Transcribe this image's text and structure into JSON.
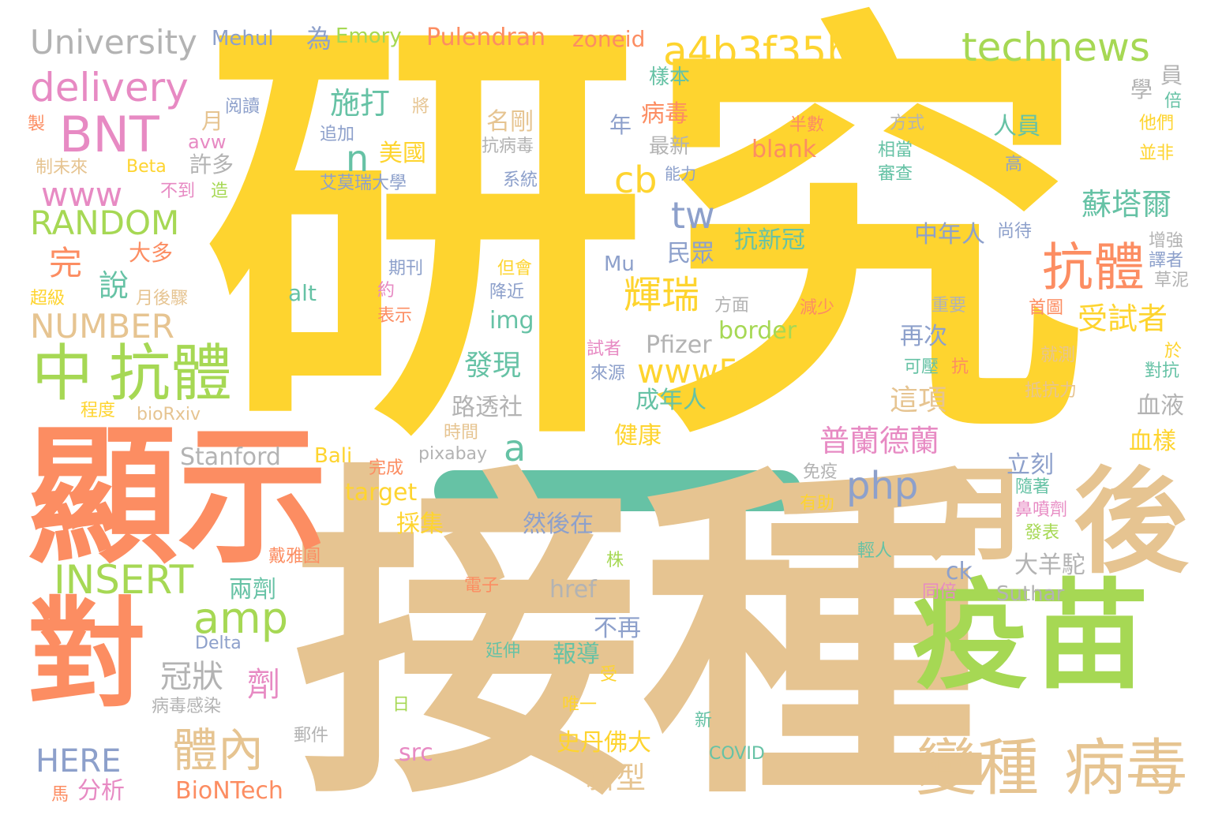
{
  "palette": {
    "yellow": "#fed42f",
    "tan": "#e6c491",
    "salmon": "#fc8d62",
    "green": "#a6d854",
    "pink": "#e78ac3",
    "blue": "#8da0cb",
    "teal": "#66c2a5",
    "gray": "#b3b3b3",
    "background": "#ffffff"
  },
  "highlight_bar": {
    "color": "#66c2a5"
  },
  "words": [
    {
      "text": "研究",
      "color": "yellow"
    },
    {
      "text": "接種",
      "color": "tan"
    },
    {
      "text": "顯示",
      "color": "salmon"
    },
    {
      "text": "對",
      "color": "salmon"
    },
    {
      "text": "疫苗",
      "color": "green"
    },
    {
      "text": "後",
      "color": "tan"
    },
    {
      "text": "月",
      "color": "tan"
    },
    {
      "text": "變種",
      "color": "tan"
    },
    {
      "text": "病毒",
      "color": "tan"
    },
    {
      "text": "中",
      "color": "green"
    },
    {
      "text": "抗體",
      "color": "green"
    },
    {
      "text": "BNT",
      "color": "pink"
    },
    {
      "text": "delivery",
      "color": "pink"
    },
    {
      "text": "University",
      "color": "gray"
    },
    {
      "text": "a4b3f35b",
      "color": "yellow"
    },
    {
      "text": "technews",
      "color": "green"
    },
    {
      "text": "www",
      "color": "pink"
    },
    {
      "text": "RANDOM",
      "color": "green"
    },
    {
      "text": "NUMBER",
      "color": "tan"
    },
    {
      "text": "INSERT",
      "color": "green"
    },
    {
      "text": "amp",
      "color": "green"
    },
    {
      "text": "php",
      "color": "blue"
    },
    {
      "text": "www5",
      "color": "yellow"
    },
    {
      "text": "抗體",
      "color": "salmon"
    },
    {
      "text": "輝瑞",
      "color": "yellow"
    },
    {
      "text": "受試者",
      "color": "yellow"
    },
    {
      "text": "蘇塔爾",
      "color": "teal"
    },
    {
      "text": "普蘭德蘭",
      "color": "pink"
    },
    {
      "text": "體內",
      "color": "tan"
    },
    {
      "text": "cb",
      "color": "yellow"
    },
    {
      "text": "tw",
      "color": "blue"
    },
    {
      "text": "施打",
      "color": "teal"
    },
    {
      "text": "n",
      "color": "teal"
    },
    {
      "text": "a",
      "color": "teal"
    },
    {
      "text": "HERE",
      "color": "blue"
    },
    {
      "text": "冠狀",
      "color": "gray"
    },
    {
      "text": "劑",
      "color": "pink"
    },
    {
      "text": "完",
      "color": "salmon"
    },
    {
      "text": "說",
      "color": "teal"
    },
    {
      "text": "發現",
      "color": "teal"
    },
    {
      "text": "這項",
      "color": "tan"
    },
    {
      "text": "新型",
      "color": "tan"
    },
    {
      "text": "史丹佛大",
      "color": "yellow"
    },
    {
      "text": "美國",
      "color": "yellow"
    },
    {
      "text": "名剛",
      "color": "tan"
    },
    {
      "text": "病毒",
      "color": "salmon"
    },
    {
      "text": "樣本",
      "color": "teal"
    },
    {
      "text": "最新",
      "color": "gray"
    },
    {
      "text": "年",
      "color": "blue"
    },
    {
      "text": "許多",
      "color": "gray"
    },
    {
      "text": "avw",
      "color": "pink"
    },
    {
      "text": "月",
      "color": "tan"
    },
    {
      "text": "大多",
      "color": "salmon"
    },
    {
      "text": "為",
      "color": "blue"
    },
    {
      "text": "Mehul",
      "color": "blue"
    },
    {
      "text": "Emory",
      "color": "green"
    },
    {
      "text": "Pulendran",
      "color": "salmon"
    },
    {
      "text": "zoneid",
      "color": "salmon"
    },
    {
      "text": "阅讀",
      "color": "blue"
    },
    {
      "text": "將",
      "color": "tan"
    },
    {
      "text": "追加",
      "color": "blue"
    },
    {
      "text": "抗病毒",
      "color": "gray"
    },
    {
      "text": "系統",
      "color": "blue"
    },
    {
      "text": "艾莫瑞大學",
      "color": "blue"
    },
    {
      "text": "能力",
      "color": "blue"
    },
    {
      "text": "blank",
      "color": "salmon"
    },
    {
      "text": "半數",
      "color": "salmon"
    },
    {
      "text": "方式",
      "color": "gray"
    },
    {
      "text": "相當",
      "color": "teal"
    },
    {
      "text": "審查",
      "color": "teal"
    },
    {
      "text": "人員",
      "color": "teal"
    },
    {
      "text": "學",
      "color": "gray"
    },
    {
      "text": "員",
      "color": "gray"
    },
    {
      "text": "倍",
      "color": "teal"
    },
    {
      "text": "他們",
      "color": "yellow"
    },
    {
      "text": "並非",
      "color": "yellow"
    },
    {
      "text": "高",
      "color": "blue"
    },
    {
      "text": "抗新冠",
      "color": "teal"
    },
    {
      "text": "民眾",
      "color": "blue"
    },
    {
      "text": "中年人",
      "color": "blue"
    },
    {
      "text": "尚待",
      "color": "blue"
    },
    {
      "text": "增強",
      "color": "gray"
    },
    {
      "text": "譯者",
      "color": "blue"
    },
    {
      "text": "草泥",
      "color": "gray"
    },
    {
      "text": "首圖",
      "color": "salmon"
    },
    {
      "text": "重要",
      "color": "gray"
    },
    {
      "text": "減少",
      "color": "salmon"
    },
    {
      "text": "方面",
      "color": "gray"
    },
    {
      "text": "Mu",
      "color": "blue"
    },
    {
      "text": "期刊",
      "color": "blue"
    },
    {
      "text": "但會",
      "color": "yellow"
    },
    {
      "text": "降近",
      "color": "blue"
    },
    {
      "text": "約",
      "color": "pink"
    },
    {
      "text": "表示",
      "color": "salmon"
    },
    {
      "text": "alt",
      "color": "teal"
    },
    {
      "text": "img",
      "color": "teal"
    },
    {
      "text": "border",
      "color": "green"
    },
    {
      "text": "Pfizer",
      "color": "gray"
    },
    {
      "text": "再次",
      "color": "blue"
    },
    {
      "text": "試者",
      "color": "pink"
    },
    {
      "text": "來源",
      "color": "blue"
    },
    {
      "text": "可壓",
      "color": "teal"
    },
    {
      "text": "抗",
      "color": "salmon"
    },
    {
      "text": "就測",
      "color": "tan"
    },
    {
      "text": "於",
      "color": "yellow"
    },
    {
      "text": "對抗",
      "color": "teal"
    },
    {
      "text": "抵抗力",
      "color": "tan"
    },
    {
      "text": "血液",
      "color": "gray"
    },
    {
      "text": "血樣",
      "color": "yellow"
    },
    {
      "text": "立刻",
      "color": "blue"
    },
    {
      "text": "成年人",
      "color": "teal"
    },
    {
      "text": "路透社",
      "color": "gray"
    },
    {
      "text": "健康",
      "color": "yellow"
    },
    {
      "text": "時間",
      "color": "tan"
    },
    {
      "text": "pixabay",
      "color": "gray"
    },
    {
      "text": "Bali",
      "color": "yellow"
    },
    {
      "text": "Stanford",
      "color": "gray"
    },
    {
      "text": "完成",
      "color": "salmon"
    },
    {
      "text": "target",
      "color": "yellow"
    },
    {
      "text": "採集",
      "color": "yellow"
    },
    {
      "text": "然後在",
      "color": "blue"
    },
    {
      "text": "免疫",
      "color": "gray"
    },
    {
      "text": "有助",
      "color": "yellow"
    },
    {
      "text": "隨著",
      "color": "teal"
    },
    {
      "text": "鼻噴劑",
      "color": "pink"
    },
    {
      "text": "發表",
      "color": "green"
    },
    {
      "text": "輕人",
      "color": "teal"
    },
    {
      "text": "大羊駝",
      "color": "gray"
    },
    {
      "text": "ck",
      "color": "blue"
    },
    {
      "text": "同倍",
      "color": "pink"
    },
    {
      "text": "Suthar",
      "color": "gray"
    },
    {
      "text": "href",
      "color": "gray"
    },
    {
      "text": "不再",
      "color": "blue"
    },
    {
      "text": "報導",
      "color": "teal"
    },
    {
      "text": "兩劑",
      "color": "teal"
    },
    {
      "text": "戴雅圓",
      "color": "salmon"
    },
    {
      "text": "株",
      "color": "green"
    },
    {
      "text": "電子",
      "color": "salmon"
    },
    {
      "text": "受",
      "color": "yellow"
    },
    {
      "text": "延伸",
      "color": "teal"
    },
    {
      "text": "唯一",
      "color": "yellow"
    },
    {
      "text": "日",
      "color": "green"
    },
    {
      "text": "新",
      "color": "teal"
    },
    {
      "text": "COVID",
      "color": "teal"
    },
    {
      "text": "src",
      "color": "pink"
    },
    {
      "text": "郵件",
      "color": "gray"
    },
    {
      "text": "病毒感染",
      "color": "gray"
    },
    {
      "text": "Delta",
      "color": "blue"
    },
    {
      "text": "分析",
      "color": "pink"
    },
    {
      "text": "BioNTech",
      "color": "salmon"
    },
    {
      "text": "馬",
      "color": "salmon"
    },
    {
      "text": "bioRxiv",
      "color": "tan"
    },
    {
      "text": "程度",
      "color": "yellow"
    },
    {
      "text": "超級",
      "color": "yellow"
    },
    {
      "text": "月後驟",
      "color": "tan"
    },
    {
      "text": "製",
      "color": "salmon"
    },
    {
      "text": "制未來",
      "color": "tan"
    },
    {
      "text": "Beta",
      "color": "yellow"
    },
    {
      "text": "不到",
      "color": "pink"
    },
    {
      "text": "造",
      "color": "green"
    }
  ]
}
